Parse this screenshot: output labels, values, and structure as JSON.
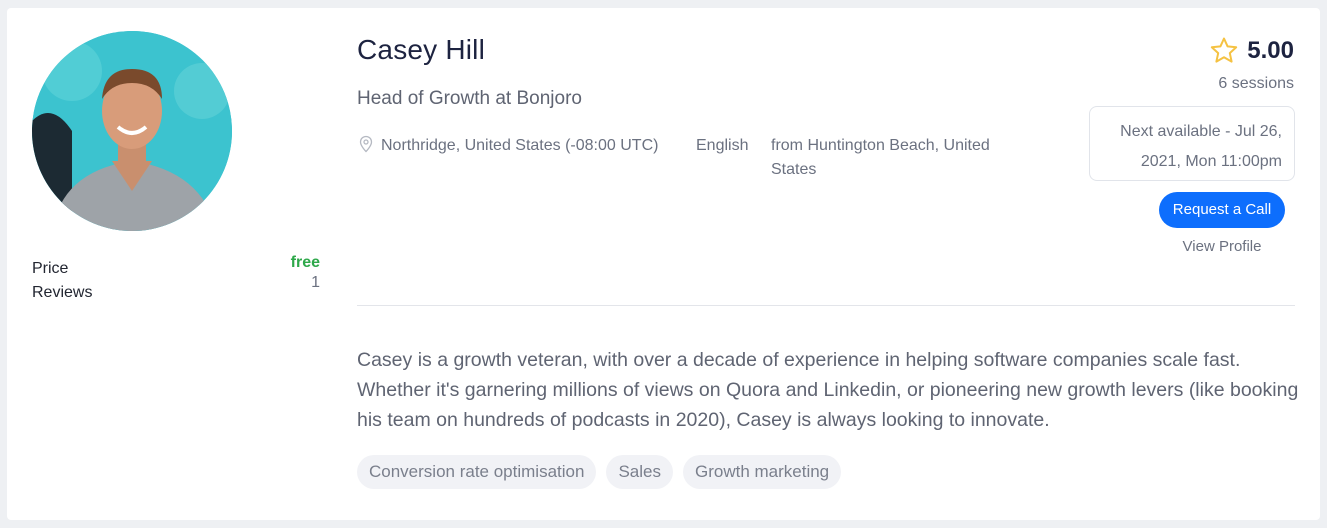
{
  "profile": {
    "name": "Casey Hill",
    "headline": "Head of Growth at Bonjoro",
    "location": "Northridge, United States (-08:00 UTC)",
    "language": "English",
    "from": "from Huntington Beach, United States",
    "bio": "Casey is a growth veteran, with over a decade of experience in helping software companies scale fast. Whether it's garnering millions of views on Quora and Linkedin, or pioneering new growth levers (like booking his team on hundreds of podcasts in 2020), Casey is always looking to innovate."
  },
  "stats": {
    "price_label": "Price",
    "price_value": "free",
    "reviews_label": "Reviews",
    "reviews_value": "1"
  },
  "rating": {
    "score": "5.00",
    "sessions": "6 sessions",
    "star_icon": "star-outline-icon",
    "star_color": "#f5c242"
  },
  "availability": {
    "next_line1": "Next available - Jul 26,",
    "next_line2": "2021, Mon 11:00pm"
  },
  "actions": {
    "request_call": "Request a Call",
    "view_profile": "View Profile"
  },
  "tags": [
    "Conversion rate optimisation",
    "Sales",
    "Growth marketing"
  ],
  "colors": {
    "accent": "#0d6efd",
    "free": "#2ea84a"
  }
}
